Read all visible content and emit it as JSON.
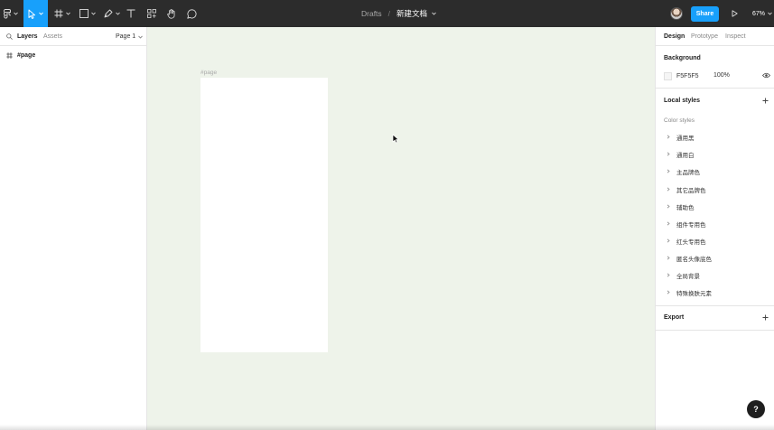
{
  "toolbar": {
    "breadcrumb_root": "Drafts",
    "separator": "/",
    "document_title": "新建文档",
    "share_label": "Share",
    "zoom": "67%",
    "accent_color": "#18a0fb"
  },
  "left_panel": {
    "tabs": [
      "Layers",
      "Assets"
    ],
    "active_tab": "Layers",
    "page_selector": "Page 1",
    "layers": [
      {
        "name": "#page",
        "icon": "frame-icon"
      }
    ]
  },
  "canvas": {
    "frame_label": "#page",
    "background": "#eef3ea"
  },
  "right_panel": {
    "tabs": [
      "Design",
      "Prototype",
      "Inspect"
    ],
    "active_tab": "Design",
    "background_section": {
      "title": "Background",
      "hex": "F5F5F5",
      "opacity": "100%"
    },
    "local_styles": {
      "title": "Local styles",
      "color_styles_label": "Color styles",
      "items": [
        "通用黑",
        "通用白",
        "主品牌色",
        "其它品牌色",
        "辅助色",
        "组件专用色",
        "红头专用色",
        "匿名头像底色",
        "全局背景",
        "特殊换肤元素"
      ]
    },
    "export": {
      "title": "Export"
    }
  },
  "help": {
    "label": "?"
  }
}
